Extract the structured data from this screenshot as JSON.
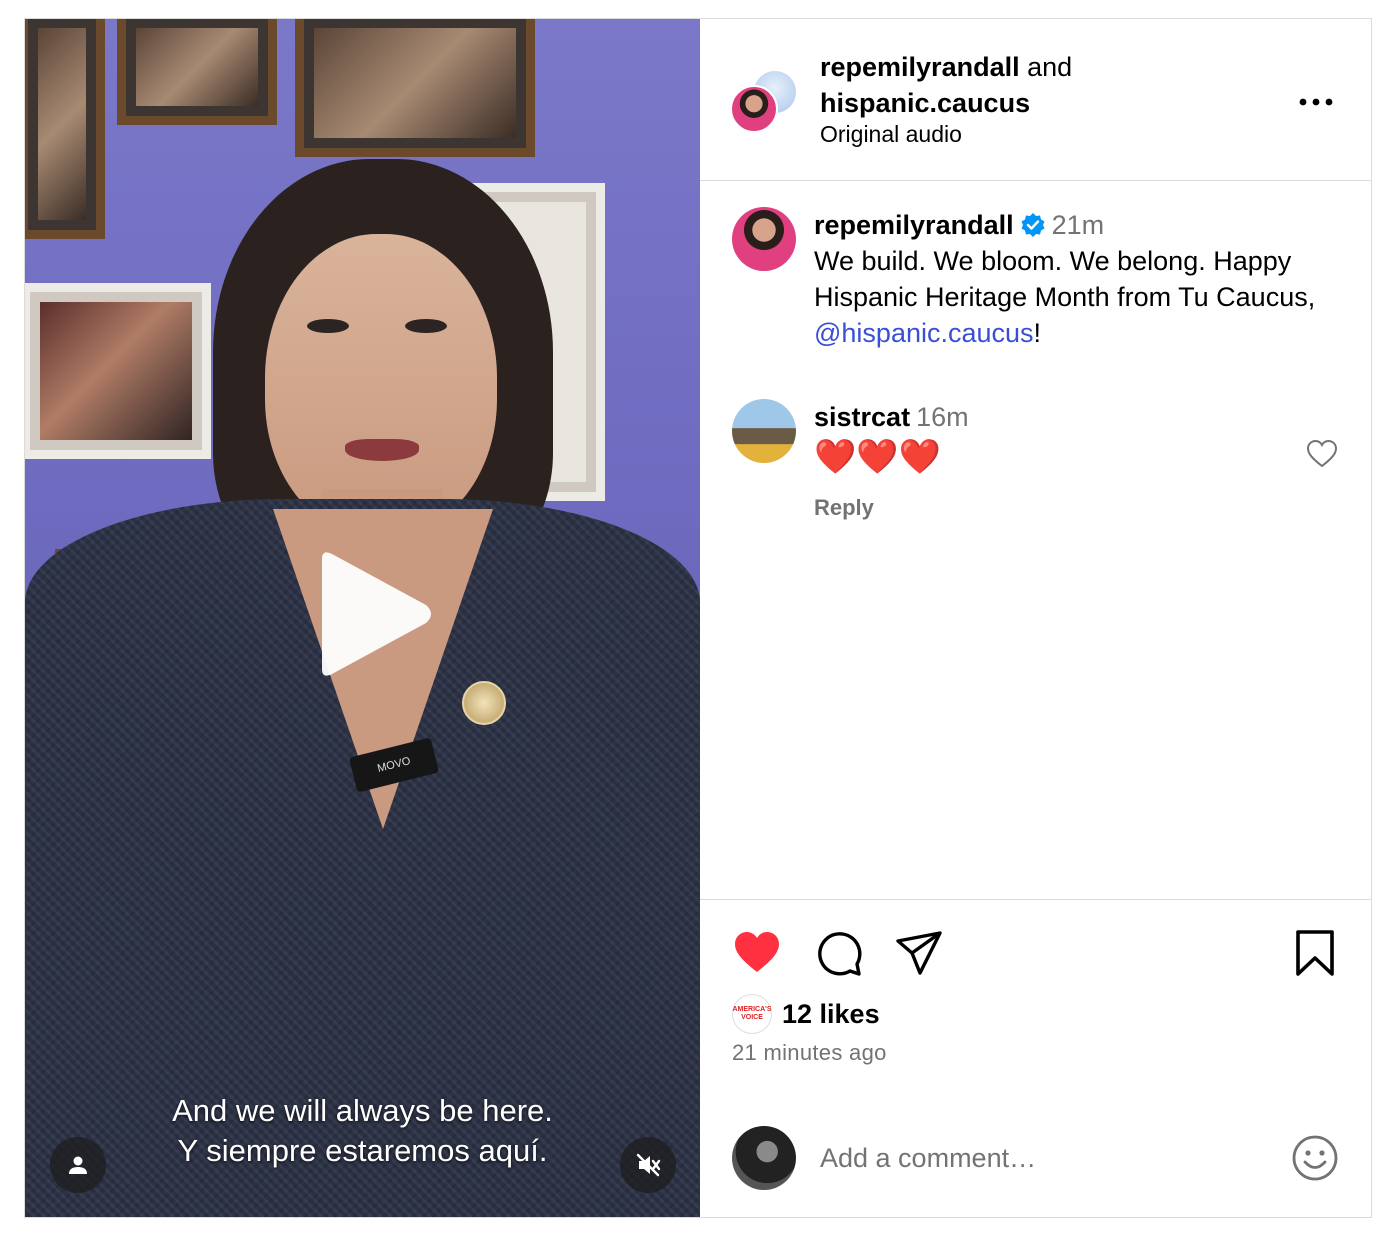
{
  "header": {
    "user1": "repemilyrandall",
    "joiner": "and",
    "user2": "hispanic.caucus",
    "audio": "Original audio"
  },
  "media": {
    "caption_line1": "And we will always be here.",
    "caption_line2": "Y siempre estaremos aquí.",
    "mic_label": "MOVO"
  },
  "post_caption": {
    "username": "repemilyrandall",
    "time": "21m",
    "text": "We build. We bloom. We belong. Happy Hispanic Heritage Month from Tu Caucus, ",
    "mention": "@hispanic.caucus",
    "text_end": "!"
  },
  "comments": [
    {
      "username": "sistrcat",
      "time": "16m",
      "text": "❤️❤️❤️",
      "reply": "Reply"
    }
  ],
  "likes": {
    "avatar_label": "AMERICA'S VOICE",
    "count": "12 likes",
    "ago": "21 minutes ago"
  },
  "add_comment": {
    "placeholder": "Add a comment…"
  },
  "colors": {
    "like_red": "#ff3040",
    "verified_blue": "#0095f6",
    "mention": "#3b4fd6"
  },
  "icons": [
    "play-icon",
    "user-tag-icon",
    "muted-icon",
    "more-icon",
    "verified-icon",
    "heart-icon",
    "comment-icon",
    "share-icon",
    "bookmark-icon",
    "emoji-icon"
  ]
}
